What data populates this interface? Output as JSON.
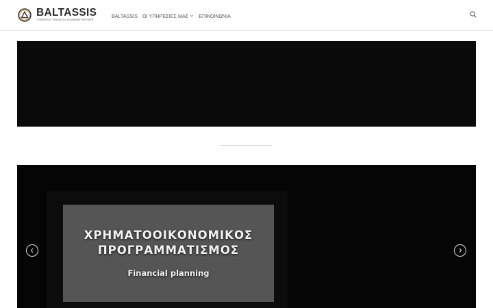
{
  "header": {
    "logo": {
      "name": "BALTASSIS",
      "tagline": "STRATEGIC FINANCIAL PLANNING PARTNER"
    },
    "nav": [
      {
        "label": "BALTASSIS"
      },
      {
        "label": "ΟΙ ΥΠΗΡΕΣΙΕΣ ΜΑΣ",
        "has_dropdown": true
      },
      {
        "label": "ΕΠΙΚΟΙΝΩΝΙΑ"
      }
    ],
    "search_icon": "search-icon"
  },
  "slider": {
    "slide": {
      "title_line1": "ΧΡΗΜΑΤΟΟΙΚΟΝΟΜΙΚΟΣ",
      "title_line2": "ΠΡΟΓΡΑΜΜΑΤΙΣΜΟΣ",
      "subtitle": "Financial planning"
    },
    "prev_icon": "chevron-left-icon",
    "next_icon": "chevron-right-icon"
  },
  "colors": {
    "header_bg": "#ffffff",
    "nav_text": "#555555",
    "banner_bg": "#0a0a0a",
    "caption_bg": "#555555",
    "caption_text": "#f2f2f2",
    "logo_accent": "#c8a04a"
  }
}
